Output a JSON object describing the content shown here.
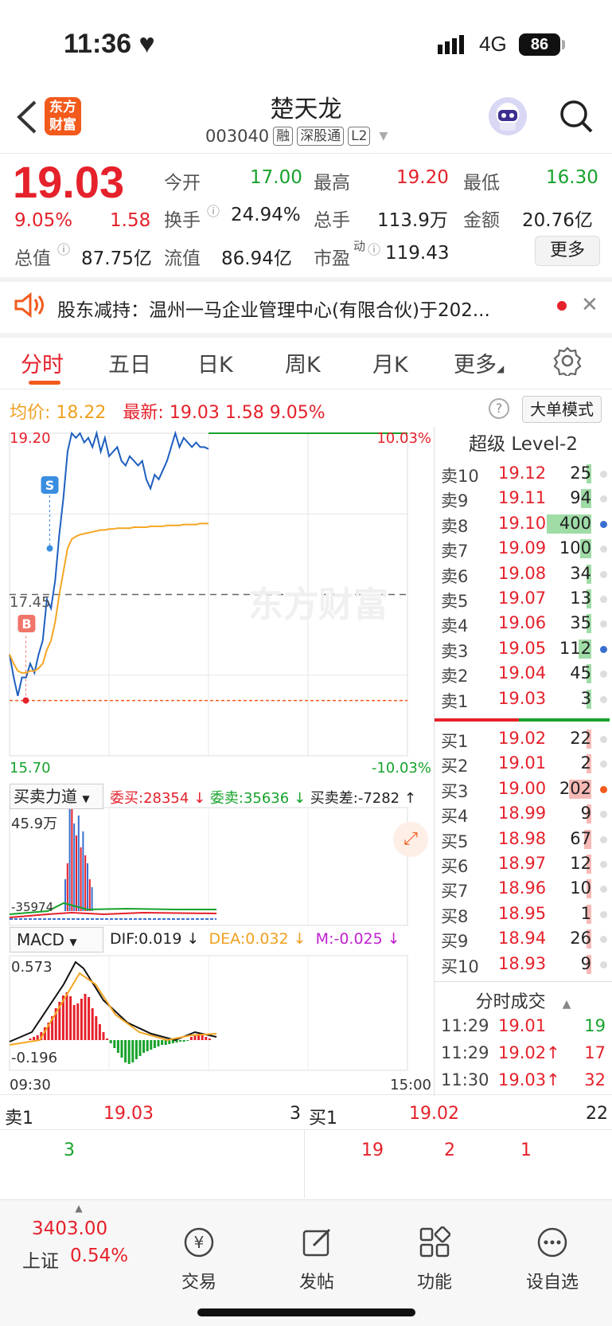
{
  "status_bar": {
    "time": "11:36",
    "network": "4G",
    "battery": "86"
  },
  "header": {
    "logo_line1": "东方",
    "logo_line2": "财富",
    "name": "楚天龙",
    "code": "003040",
    "tags": [
      "融",
      "深股通",
      "L2"
    ]
  },
  "quote": {
    "price": "19.03",
    "change_pct": "9.05%",
    "change": "1.58",
    "open_label": "今开",
    "open": "17.00",
    "high_label": "最高",
    "high": "19.20",
    "low_label": "最低",
    "low": "16.30",
    "turnover_label": "换手",
    "turnover": "24.94%",
    "volume_label": "总手",
    "volume": "113.9万",
    "amount_label": "金额",
    "amount": "20.76亿",
    "mktcap_label": "总值",
    "mktcap": "87.75亿",
    "float_label": "流值",
    "float_cap": "86.94亿",
    "pe_label": "市盈",
    "pe_sup": "动",
    "pe": "119.43",
    "more_btn": "更多"
  },
  "notice": {
    "text": "股东减持：温州一马企业管理中心(有限合伙)于202..."
  },
  "tabs": [
    "分时",
    "五日",
    "日K",
    "周K",
    "月K",
    "更多"
  ],
  "info_row": {
    "avg_label": "均价:",
    "avg": "18.22",
    "latest_label": "最新:",
    "latest": "19.03",
    "chg": "1.58",
    "pct": "9.05%",
    "big_order_btn": "大单模式"
  },
  "chart_data": {
    "type": "line",
    "ylim": [
      15.7,
      19.2
    ],
    "y_ticks_left": [
      "19.20",
      "17.45",
      "15.70"
    ],
    "y_ticks_right": [
      "10.03%",
      "-10.03%"
    ],
    "x_labels": [
      "09:30",
      "15:00"
    ],
    "prev_close": 17.45,
    "watermark": "东方财富",
    "series": [
      {
        "name": "最新",
        "color": "#1f5fbf",
        "values": [
          16.8,
          16.55,
          16.35,
          16.55,
          16.55,
          16.7,
          16.6,
          16.8,
          16.95,
          17.4,
          17.3,
          17.6,
          18.1,
          18.5,
          19.0,
          19.2,
          19.15,
          19.2,
          19.1,
          19.15,
          19.05,
          19.2,
          19.0,
          19.15,
          18.95,
          19.0,
          19.05,
          18.9,
          18.85,
          18.95,
          18.9,
          18.85,
          18.9,
          18.7,
          18.6,
          18.75,
          18.7,
          18.8,
          18.9,
          19.05,
          19.2,
          19.05,
          19.15,
          19.1,
          19.05,
          19.1,
          19.05,
          19.05,
          19.03
        ]
      },
      {
        "name": "均价",
        "color": "#f5a623",
        "values": [
          16.8,
          16.7,
          16.62,
          16.6,
          16.6,
          16.62,
          16.62,
          16.65,
          16.7,
          16.85,
          16.95,
          17.15,
          17.45,
          17.7,
          17.95,
          18.05,
          18.08,
          18.1,
          18.11,
          18.12,
          18.13,
          18.14,
          18.15,
          18.15,
          18.16,
          18.16,
          18.17,
          18.17,
          18.17,
          18.17,
          18.18,
          18.18,
          18.18,
          18.18,
          18.19,
          18.19,
          18.19,
          18.19,
          18.2,
          18.2,
          18.2,
          18.2,
          18.21,
          18.21,
          18.21,
          18.21,
          18.22,
          18.22,
          18.22
        ]
      }
    ],
    "markers": [
      {
        "label": "B",
        "price": 16.3
      },
      {
        "label": "S",
        "price": 17.95
      }
    ],
    "total_points": 240
  },
  "order_book": {
    "title": "超级 Level-2",
    "asks": [
      {
        "label": "卖10",
        "price": "19.12",
        "vol": "25"
      },
      {
        "label": "卖9",
        "price": "19.11",
        "vol": "94"
      },
      {
        "label": "卖8",
        "price": "19.10",
        "vol": "400"
      },
      {
        "label": "卖7",
        "price": "19.09",
        "vol": "100"
      },
      {
        "label": "卖6",
        "price": "19.08",
        "vol": "34"
      },
      {
        "label": "卖5",
        "price": "19.07",
        "vol": "13"
      },
      {
        "label": "卖4",
        "price": "19.06",
        "vol": "35"
      },
      {
        "label": "卖3",
        "price": "19.05",
        "vol": "112"
      },
      {
        "label": "卖2",
        "price": "19.04",
        "vol": "45"
      },
      {
        "label": "卖1",
        "price": "19.03",
        "vol": "3"
      }
    ],
    "bids": [
      {
        "label": "买1",
        "price": "19.02",
        "vol": "22"
      },
      {
        "label": "买2",
        "price": "19.01",
        "vol": "2"
      },
      {
        "label": "买3",
        "price": "19.00",
        "vol": "202"
      },
      {
        "label": "买4",
        "price": "18.99",
        "vol": "9"
      },
      {
        "label": "买5",
        "price": "18.98",
        "vol": "67"
      },
      {
        "label": "买6",
        "price": "18.97",
        "vol": "12"
      },
      {
        "label": "买7",
        "price": "18.96",
        "vol": "10"
      },
      {
        "label": "买8",
        "price": "18.95",
        "vol": "1"
      },
      {
        "label": "买9",
        "price": "18.94",
        "vol": "26"
      },
      {
        "label": "买10",
        "price": "18.93",
        "vol": "9"
      }
    ]
  },
  "buy_sell_force": {
    "select": "买卖力道",
    "bid_label": "委买:",
    "bid": "28354",
    "ask_label": "委卖:",
    "ask": "35636",
    "diff_label": "买卖差:",
    "diff": "-7282",
    "max_label": "45.9万",
    "min_label": "-35974"
  },
  "macd": {
    "select": "MACD",
    "dif": "DIF:0.019",
    "dea": "DEA:0.032",
    "m": "M:-0.025",
    "max_label": "0.573",
    "min_label": "-0.196"
  },
  "trades": {
    "title": "分时成交",
    "rows": [
      {
        "time": "11:29",
        "price": "19.01",
        "vol": "19",
        "dir": ""
      },
      {
        "time": "11:29",
        "price": "19.02",
        "vol": "17",
        "dir": "↑"
      },
      {
        "time": "11:30",
        "price": "19.03",
        "vol": "32",
        "dir": "↑"
      }
    ]
  },
  "level1": {
    "ask_label": "卖1",
    "ask_price": "19.03",
    "ask_vol": "3",
    "bid_label": "买1",
    "bid_price": "19.02",
    "bid_vol": "22",
    "ask_queue": [
      "3"
    ],
    "bid_queue": [
      "19",
      "2",
      "1"
    ]
  },
  "bottom_nav": {
    "index_value": "3403.00",
    "index_name": "上证",
    "index_pct": "0.54%",
    "items": [
      "交易",
      "发帖",
      "功能",
      "设自选"
    ]
  },
  "colors": {
    "up": "#e5212b",
    "down": "#17a22b",
    "brand": "#f25a1c",
    "price_line": "#1f5fbf",
    "avg_line": "#f5a623"
  }
}
